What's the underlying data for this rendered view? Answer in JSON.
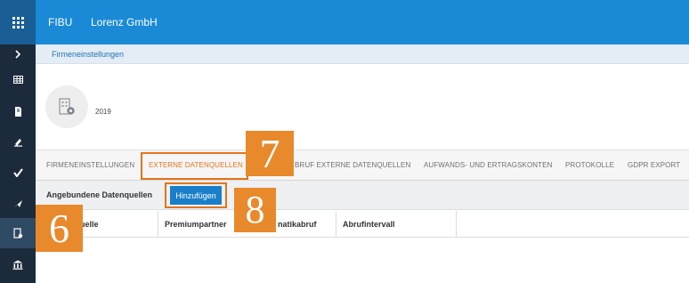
{
  "header": {
    "brand": "FIBU",
    "company": "Lorenz GmbH"
  },
  "breadcrumb": "Firmeneinstellungen",
  "entity": {
    "year": "2019"
  },
  "tabs": [
    {
      "label": "FIRMENEINSTELLUNGEN"
    },
    {
      "label": "EXTERNE DATENQUELLEN",
      "active": true
    },
    {
      "label": "BRUF EXTERNE DATENQUELLEN"
    },
    {
      "label": "AUFWANDS- UND ERTRAGSKONTEN"
    },
    {
      "label": "PROTOKOLLE"
    },
    {
      "label": "GDPR EXPORT"
    }
  ],
  "toolbar": {
    "label": "Angebundene Datenquellen",
    "add_button": "Hinzufügen"
  },
  "table": {
    "columns": [
      "uelle",
      "Premiumpartner",
      "natikabruf",
      "Abrufintervall"
    ]
  },
  "callouts": {
    "step6": "6",
    "step7": "7",
    "step8": "8"
  },
  "sidebar": {
    "icons": [
      "chevron-right-icon",
      "table-icon",
      "document-icon",
      "edit-icon",
      "checkmark-icon",
      "send-icon",
      "building-settings-icon",
      "bank-icon"
    ]
  },
  "colors": {
    "topbar": "#1a8ad6",
    "sidebar": "#1c2b3c",
    "accent": "#e4741a",
    "callout": "#e8892b",
    "button": "#1a7fc8"
  }
}
